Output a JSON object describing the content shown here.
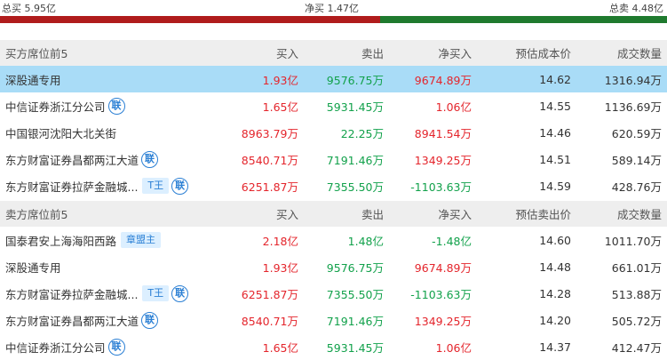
{
  "summary": {
    "buy_total": "总买 5.95亿",
    "net_total": "净买 1.47亿",
    "sell_total": "总卖 4.48亿",
    "buy_share_pct": 57,
    "colors": {
      "buy": "#b01c1c",
      "sell": "#1f7a2e",
      "highlight": "#a9dcf7"
    }
  },
  "buy_section": {
    "headers": [
      "买方席位前5",
      "买入",
      "卖出",
      "净买入",
      "预估成本价",
      "成交数量"
    ],
    "rows": [
      {
        "name": "深股通专用",
        "badge": "",
        "tag": "",
        "buy": "1.93亿",
        "sell": "9576.75万",
        "net": "9674.89万",
        "price": "14.62",
        "volume": "1316.94万",
        "highlight": true
      },
      {
        "name": "中信证券浙江分公司",
        "badge": "联",
        "tag": "",
        "buy": "1.65亿",
        "sell": "5931.45万",
        "net": "1.06亿",
        "price": "14.55",
        "volume": "1136.69万"
      },
      {
        "name": "中国银河沈阳大北关街",
        "badge": "",
        "tag": "",
        "buy": "8963.79万",
        "sell": "22.25万",
        "net": "8941.54万",
        "price": "14.46",
        "volume": "620.59万"
      },
      {
        "name": "东方财富证券昌都两江大道",
        "badge": "联",
        "tag": "",
        "buy": "8540.71万",
        "sell": "7191.46万",
        "net": "1349.25万",
        "price": "14.51",
        "volume": "589.14万"
      },
      {
        "name": "东方财富证券拉萨金融城...",
        "badge": "联",
        "tag": "T王",
        "buy": "6251.87万",
        "sell": "7355.50万",
        "net": "-1103.63万",
        "price": "14.59",
        "volume": "428.76万"
      }
    ]
  },
  "sell_section": {
    "headers": [
      "卖方席位前5",
      "买入",
      "卖出",
      "净买入",
      "预估卖出价",
      "成交数量"
    ],
    "rows": [
      {
        "name": "国泰君安上海海阳西路",
        "badge": "",
        "tag": "章盟主",
        "buy": "2.18亿",
        "sell": "1.48亿",
        "net": "-1.48亿",
        "price": "14.60",
        "volume": "1011.70万"
      },
      {
        "name": "深股通专用",
        "badge": "",
        "tag": "",
        "buy": "1.93亿",
        "sell": "9576.75万",
        "net": "9674.89万",
        "price": "14.48",
        "volume": "661.01万"
      },
      {
        "name": "东方财富证券拉萨金融城...",
        "badge": "联",
        "tag": "T王",
        "buy": "6251.87万",
        "sell": "7355.50万",
        "net": "-1103.63万",
        "price": "14.28",
        "volume": "513.88万"
      },
      {
        "name": "东方财富证券昌都两江大道",
        "badge": "联",
        "tag": "",
        "buy": "8540.71万",
        "sell": "7191.46万",
        "net": "1349.25万",
        "price": "14.20",
        "volume": "505.72万"
      },
      {
        "name": "中信证券浙江分公司",
        "badge": "联",
        "tag": "",
        "buy": "1.65亿",
        "sell": "5931.45万",
        "net": "1.06亿",
        "price": "14.37",
        "volume": "412.47万"
      }
    ]
  }
}
